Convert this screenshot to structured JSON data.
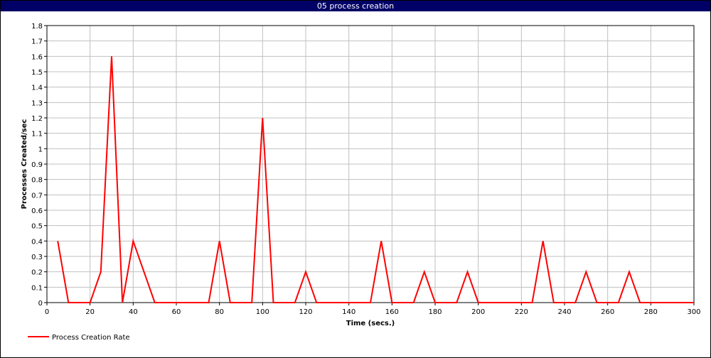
{
  "window": {
    "title": "05 process creation"
  },
  "colors": {
    "series": "#ff0000",
    "grid": "#c0c0c0",
    "titlebar": "#000066"
  },
  "chart_data": {
    "type": "line",
    "title": "05 process creation",
    "xlabel": "Time (secs.)",
    "ylabel": "Processes Created/sec",
    "xlim": [
      0,
      300
    ],
    "ylim": [
      0,
      1.8
    ],
    "xticks": [
      0,
      20,
      40,
      60,
      80,
      100,
      120,
      140,
      160,
      180,
      200,
      220,
      240,
      260,
      280,
      300
    ],
    "yticks": [
      0,
      0.1,
      0.2,
      0.3,
      0.4,
      0.5,
      0.6,
      0.7,
      0.8,
      0.9,
      1,
      1.1,
      1.2,
      1.3,
      1.4,
      1.5,
      1.6,
      1.7,
      1.8
    ],
    "grid": true,
    "legend_position": "bottom-left",
    "series": [
      {
        "name": "Process Creation Rate",
        "color": "#ff0000",
        "x": [
          5,
          10,
          15,
          20,
          25,
          30,
          35,
          40,
          45,
          50,
          55,
          60,
          65,
          70,
          75,
          80,
          85,
          90,
          95,
          100,
          105,
          110,
          115,
          120,
          125,
          130,
          135,
          140,
          145,
          150,
          155,
          160,
          165,
          170,
          175,
          180,
          185,
          190,
          195,
          200,
          205,
          210,
          215,
          220,
          225,
          230,
          235,
          240,
          245,
          250,
          255,
          260,
          265,
          270,
          275,
          280,
          285,
          290,
          295,
          300
        ],
        "y": [
          0.4,
          0,
          0,
          0,
          0.2,
          1.6,
          0,
          0.4,
          0.2,
          0,
          0,
          0,
          0,
          0,
          0,
          0.4,
          0,
          0,
          0,
          1.2,
          0,
          0,
          0,
          0.2,
          0,
          0,
          0,
          0,
          0,
          0,
          0.4,
          0,
          0,
          0,
          0.2,
          0,
          0,
          0,
          0.2,
          0,
          0,
          0,
          0,
          0,
          0,
          0.4,
          0,
          0,
          0,
          0.2,
          0,
          0,
          0,
          0.2,
          0,
          0,
          0,
          0,
          0,
          0
        ]
      }
    ]
  }
}
